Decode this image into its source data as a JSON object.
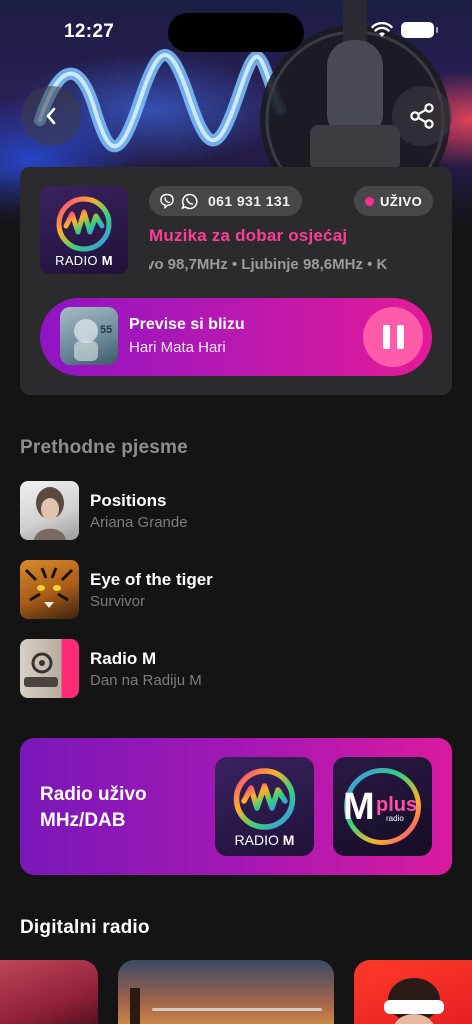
{
  "status_bar": {
    "time": "12:27"
  },
  "header": {
    "back_icon": "chevron-left-icon",
    "share_icon": "share-icon"
  },
  "station": {
    "logo_text_light": "RADIO ",
    "logo_text_bold": "M",
    "phone": "061 931 131",
    "live_label": "UŽIVO",
    "slogan": "Muzika za dobar osjećaj",
    "frequencies": "vo 98,7MHz • Ljubinje 98,6MHz • K"
  },
  "now_playing": {
    "title": "Previse si blizu",
    "artist": "Hari Mata Hari"
  },
  "previous": {
    "title": "Prethodne pjesme",
    "tracks": [
      {
        "title": "Positions",
        "artist": "Ariana Grande"
      },
      {
        "title": "Eye of the tiger",
        "artist": "Survivor"
      },
      {
        "title": "Radio M",
        "artist": "Dan na Radiju M"
      }
    ]
  },
  "live_banner": {
    "text": "Radio uživo MHz/DAB",
    "logo_m_light": "RADIO ",
    "logo_m_bold": "M",
    "logo_plus_m": "M",
    "logo_plus_word": "plus",
    "logo_plus_sub": "radio"
  },
  "digital": {
    "title": "Digitalni radio"
  },
  "colors": {
    "accent": "#ff3d96",
    "live_dot": "#ff2f8f",
    "card": "#2b2b2d",
    "background": "#141414"
  }
}
